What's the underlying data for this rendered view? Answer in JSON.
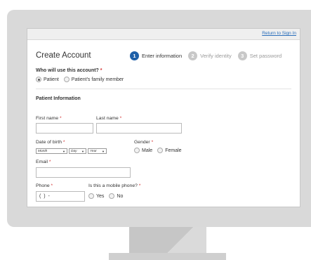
{
  "header": {
    "return_link": "Return to Sign In",
    "title": "Create Account"
  },
  "steps": [
    {
      "num": "1",
      "label": "Enter information",
      "state": "active"
    },
    {
      "num": "2",
      "label": "Verify identity",
      "state": "inactive"
    },
    {
      "num": "3",
      "label": "Set password",
      "state": "inactive"
    }
  ],
  "who": {
    "question": "Who will use this account?",
    "required_mark": "*",
    "options": [
      {
        "label": "Patient",
        "checked": true
      },
      {
        "label": "Patient's family member",
        "checked": false
      }
    ]
  },
  "patient_info": {
    "section_title": "Patient Information",
    "first_name_label": "First name",
    "last_name_label": "Last name",
    "dob_label": "Date of birth",
    "dob_month": "Month",
    "dob_day": "Day",
    "dob_year": "Year",
    "gender_label": "Gender",
    "gender_options": [
      "Male",
      "Female"
    ],
    "email_label": "Email",
    "phone_label": "Phone",
    "phone_value": "(  )  -",
    "mobile_label": "Is this a mobile phone?",
    "mobile_options": [
      "Yes",
      "No"
    ],
    "required_mark": "*"
  },
  "colors": {
    "accent": "#1e5fa8",
    "link": "#2a6ebb",
    "required": "#d32f2f"
  }
}
